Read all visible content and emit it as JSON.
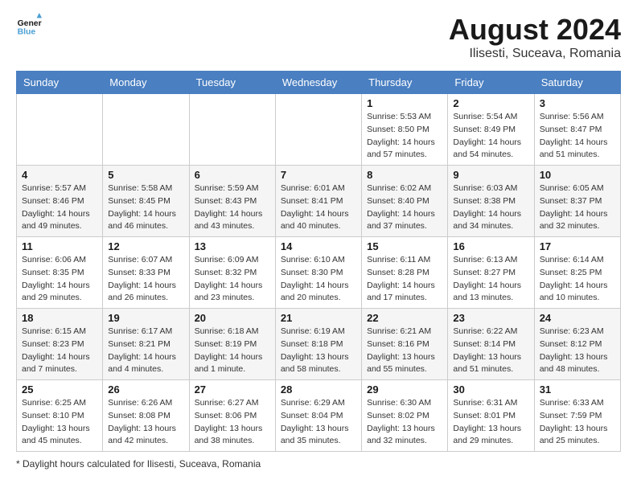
{
  "header": {
    "logo_line1": "General",
    "logo_line2": "Blue",
    "month_title": "August 2024",
    "location": "Ilisesti, Suceava, Romania"
  },
  "weekdays": [
    "Sunday",
    "Monday",
    "Tuesday",
    "Wednesday",
    "Thursday",
    "Friday",
    "Saturday"
  ],
  "footer": {
    "note": "Daylight hours"
  },
  "weeks": [
    [
      {
        "day": "",
        "info": ""
      },
      {
        "day": "",
        "info": ""
      },
      {
        "day": "",
        "info": ""
      },
      {
        "day": "",
        "info": ""
      },
      {
        "day": "1",
        "info": "Sunrise: 5:53 AM\nSunset: 8:50 PM\nDaylight: 14 hours\nand 57 minutes."
      },
      {
        "day": "2",
        "info": "Sunrise: 5:54 AM\nSunset: 8:49 PM\nDaylight: 14 hours\nand 54 minutes."
      },
      {
        "day": "3",
        "info": "Sunrise: 5:56 AM\nSunset: 8:47 PM\nDaylight: 14 hours\nand 51 minutes."
      }
    ],
    [
      {
        "day": "4",
        "info": "Sunrise: 5:57 AM\nSunset: 8:46 PM\nDaylight: 14 hours\nand 49 minutes."
      },
      {
        "day": "5",
        "info": "Sunrise: 5:58 AM\nSunset: 8:45 PM\nDaylight: 14 hours\nand 46 minutes."
      },
      {
        "day": "6",
        "info": "Sunrise: 5:59 AM\nSunset: 8:43 PM\nDaylight: 14 hours\nand 43 minutes."
      },
      {
        "day": "7",
        "info": "Sunrise: 6:01 AM\nSunset: 8:41 PM\nDaylight: 14 hours\nand 40 minutes."
      },
      {
        "day": "8",
        "info": "Sunrise: 6:02 AM\nSunset: 8:40 PM\nDaylight: 14 hours\nand 37 minutes."
      },
      {
        "day": "9",
        "info": "Sunrise: 6:03 AM\nSunset: 8:38 PM\nDaylight: 14 hours\nand 34 minutes."
      },
      {
        "day": "10",
        "info": "Sunrise: 6:05 AM\nSunset: 8:37 PM\nDaylight: 14 hours\nand 32 minutes."
      }
    ],
    [
      {
        "day": "11",
        "info": "Sunrise: 6:06 AM\nSunset: 8:35 PM\nDaylight: 14 hours\nand 29 minutes."
      },
      {
        "day": "12",
        "info": "Sunrise: 6:07 AM\nSunset: 8:33 PM\nDaylight: 14 hours\nand 26 minutes."
      },
      {
        "day": "13",
        "info": "Sunrise: 6:09 AM\nSunset: 8:32 PM\nDaylight: 14 hours\nand 23 minutes."
      },
      {
        "day": "14",
        "info": "Sunrise: 6:10 AM\nSunset: 8:30 PM\nDaylight: 14 hours\nand 20 minutes."
      },
      {
        "day": "15",
        "info": "Sunrise: 6:11 AM\nSunset: 8:28 PM\nDaylight: 14 hours\nand 17 minutes."
      },
      {
        "day": "16",
        "info": "Sunrise: 6:13 AM\nSunset: 8:27 PM\nDaylight: 14 hours\nand 13 minutes."
      },
      {
        "day": "17",
        "info": "Sunrise: 6:14 AM\nSunset: 8:25 PM\nDaylight: 14 hours\nand 10 minutes."
      }
    ],
    [
      {
        "day": "18",
        "info": "Sunrise: 6:15 AM\nSunset: 8:23 PM\nDaylight: 14 hours\nand 7 minutes."
      },
      {
        "day": "19",
        "info": "Sunrise: 6:17 AM\nSunset: 8:21 PM\nDaylight: 14 hours\nand 4 minutes."
      },
      {
        "day": "20",
        "info": "Sunrise: 6:18 AM\nSunset: 8:19 PM\nDaylight: 14 hours\nand 1 minute."
      },
      {
        "day": "21",
        "info": "Sunrise: 6:19 AM\nSunset: 8:18 PM\nDaylight: 13 hours\nand 58 minutes."
      },
      {
        "day": "22",
        "info": "Sunrise: 6:21 AM\nSunset: 8:16 PM\nDaylight: 13 hours\nand 55 minutes."
      },
      {
        "day": "23",
        "info": "Sunrise: 6:22 AM\nSunset: 8:14 PM\nDaylight: 13 hours\nand 51 minutes."
      },
      {
        "day": "24",
        "info": "Sunrise: 6:23 AM\nSunset: 8:12 PM\nDaylight: 13 hours\nand 48 minutes."
      }
    ],
    [
      {
        "day": "25",
        "info": "Sunrise: 6:25 AM\nSunset: 8:10 PM\nDaylight: 13 hours\nand 45 minutes."
      },
      {
        "day": "26",
        "info": "Sunrise: 6:26 AM\nSunset: 8:08 PM\nDaylight: 13 hours\nand 42 minutes."
      },
      {
        "day": "27",
        "info": "Sunrise: 6:27 AM\nSunset: 8:06 PM\nDaylight: 13 hours\nand 38 minutes."
      },
      {
        "day": "28",
        "info": "Sunrise: 6:29 AM\nSunset: 8:04 PM\nDaylight: 13 hours\nand 35 minutes."
      },
      {
        "day": "29",
        "info": "Sunrise: 6:30 AM\nSunset: 8:02 PM\nDaylight: 13 hours\nand 32 minutes."
      },
      {
        "day": "30",
        "info": "Sunrise: 6:31 AM\nSunset: 8:01 PM\nDaylight: 13 hours\nand 29 minutes."
      },
      {
        "day": "31",
        "info": "Sunrise: 6:33 AM\nSunset: 7:59 PM\nDaylight: 13 hours\nand 25 minutes."
      }
    ]
  ]
}
